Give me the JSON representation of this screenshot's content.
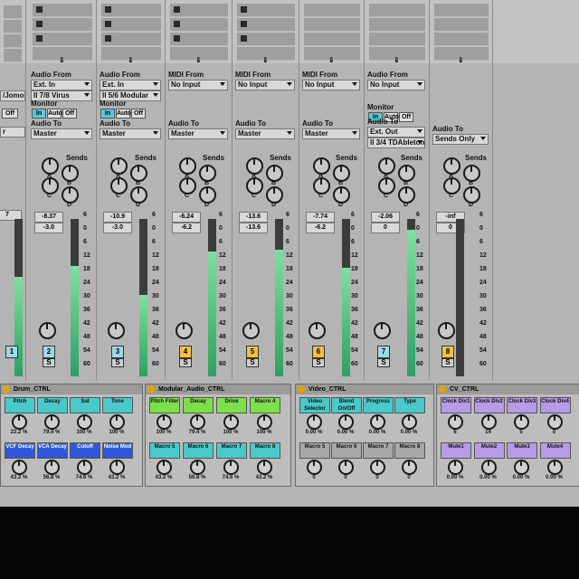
{
  "colors": {
    "aqua": "#49c9c9",
    "green": "#7de04a",
    "blue": "#2f58d8",
    "purple": "#b79be6",
    "meter_green": "#3fb56e",
    "yellow": "#f0c040"
  },
  "tracks": [
    {
      "io_label": "Audio From",
      "input": "Ext. In",
      "channel": "7/8 Virus",
      "monitor_label": "Monitor",
      "monitor": [
        "In",
        "Auto",
        "Off"
      ],
      "out_label": "Audio To",
      "output": "Master",
      "sends": "Sends",
      "vol": "-8.37",
      "peak": "-3.0",
      "num": "2",
      "num_color": "#9fd8e6"
    },
    {
      "io_label": "Audio From",
      "input": "Ext. In",
      "channel": "5/6 Modular",
      "monitor_label": "Monitor",
      "monitor": [
        "In",
        "Auto",
        "Off"
      ],
      "out_label": "Audio To",
      "output": "Master",
      "sends": "Sends",
      "vol": "-10.9",
      "peak": "-3.0",
      "num": "3",
      "num_color": "#9fd8e6"
    },
    {
      "io_label": "MIDI From",
      "input": "No Input",
      "channel": "",
      "monitor_label": "",
      "monitor": [],
      "out_label": "Audio To",
      "output": "Master",
      "sends": "Sends",
      "vol": "-6.24",
      "peak": "-6.2",
      "num": "4",
      "num_color": "#f0c040"
    },
    {
      "io_label": "MIDI From",
      "input": "No Input",
      "channel": "",
      "monitor_label": "",
      "monitor": [],
      "out_label": "Audio To",
      "output": "Master",
      "sends": "Sends",
      "vol": "-13.6",
      "peak": "-13.6",
      "num": "5",
      "num_color": "#f0c040"
    },
    {
      "io_label": "MIDI From",
      "input": "No Input",
      "channel": "",
      "monitor_label": "",
      "monitor": [],
      "out_label": "Audio To",
      "output": "Master",
      "sends": "Sends",
      "vol": "-7.74",
      "peak": "-6.2",
      "num": "6",
      "num_color": "#f0c040"
    },
    {
      "io_label": "Audio From",
      "input": "No Input",
      "channel": "",
      "monitor_label": "Monitor",
      "monitor": [
        "In",
        "Auto",
        "Off"
      ],
      "out_label": "Audio To",
      "output": "Ext. Out",
      "channel_out": "3/4 TDAbleton",
      "sends": "Sends",
      "vol": "-2.06",
      "peak": "0",
      "num": "7",
      "num_color": "#9fd8e6"
    },
    {
      "io_label": "",
      "input": "",
      "channel": "",
      "monitor_label": "",
      "monitor": [],
      "out_label": "Audio To",
      "output": "Sends Only",
      "sends": "Sends",
      "vol": "-inf",
      "peak": "0",
      "num": "8",
      "num_color": "#f0c040"
    }
  ],
  "left_partial": {
    "channel": "/Jomo",
    "monitor_off": "Off",
    "output": "r",
    "vol": "7",
    "num": "1"
  },
  "scale": [
    "6",
    "0",
    "6",
    "12",
    "18",
    "24",
    "30",
    "36",
    "42",
    "48",
    "54",
    "60"
  ],
  "send_knobs": [
    "A",
    "B",
    "C",
    "D"
  ],
  "devices": [
    {
      "title": "Drum_CTRL",
      "row1": [
        {
          "label": "Pitch",
          "color": "#49c9c9"
        },
        {
          "label": "Decay",
          "color": "#49c9c9"
        },
        {
          "label": "Sat",
          "color": "#49c9c9"
        },
        {
          "label": "Tone",
          "color": "#49c9c9"
        }
      ],
      "row1_vals": [
        "22.2 %",
        "79.4 %",
        "100 %",
        "100 %"
      ],
      "row2": [
        {
          "label": "VCF Decay",
          "color": "#2f58d8"
        },
        {
          "label": "VCA Decay",
          "color": "#2f58d8"
        },
        {
          "label": "Cutoff",
          "color": "#2f58d8"
        },
        {
          "label": "Noise Mod",
          "color": "#2f58d8"
        }
      ],
      "row2_vals": [
        "43.2 %",
        "56.8 %",
        "74.6 %",
        "43.2 %"
      ]
    },
    {
      "title": "Modular_Audio_CTRL",
      "row1": [
        {
          "label": "Pitch Filter",
          "color": "#7de04a"
        },
        {
          "label": "Decay",
          "color": "#7de04a"
        },
        {
          "label": "Drive",
          "color": "#7de04a"
        },
        {
          "label": "Macro 4",
          "color": "#7de04a"
        }
      ],
      "row1_vals": [
        "100 %",
        "79.4 %",
        "100 %",
        "100 %"
      ],
      "row2": [
        {
          "label": "Macro 5",
          "color": "#49c9c9"
        },
        {
          "label": "Macro 6",
          "color": "#49c9c9"
        },
        {
          "label": "Macro 7",
          "color": "#49c9c9"
        },
        {
          "label": "Macro 8",
          "color": "#49c9c9"
        }
      ],
      "row2_vals": [
        "43.2 %",
        "56.8 %",
        "74.6 %",
        "43.2 %"
      ]
    },
    {
      "title": "Video_CTRL",
      "row1": [
        {
          "label": "Video Selector",
          "color": "#49c9c9"
        },
        {
          "label": "Blend On/Off",
          "color": "#49c9c9"
        },
        {
          "label": "Progress",
          "color": "#49c9c9"
        },
        {
          "label": "Type",
          "color": "#49c9c9"
        }
      ],
      "row1_vals": [
        "0.00 %",
        "0.00 %",
        "0.00 %",
        "0.00 %"
      ],
      "row2": [
        {
          "label": "Macro 5",
          "color": "#a8a8a8"
        },
        {
          "label": "Macro 6",
          "color": "#a8a8a8"
        },
        {
          "label": "Macro 7",
          "color": "#a8a8a8"
        },
        {
          "label": "Macro 8",
          "color": "#a8a8a8"
        }
      ],
      "row2_vals": [
        "0",
        "0",
        "0",
        "0"
      ]
    },
    {
      "title": "CV_CTRL",
      "row1": [
        {
          "label": "Clock Div1",
          "color": "#b79be6"
        },
        {
          "label": "Clock Div2",
          "color": "#b79be6"
        },
        {
          "label": "Clock Div3",
          "color": "#b79be6"
        },
        {
          "label": "Clock Div4",
          "color": "#b79be6"
        }
      ],
      "row1_vals": [
        "6",
        "14",
        "5",
        "0"
      ],
      "row2": [
        {
          "label": "Mute1",
          "color": "#b79be6"
        },
        {
          "label": "Mute2",
          "color": "#b79be6"
        },
        {
          "label": "Mute3",
          "color": "#b79be6"
        },
        {
          "label": "Mute4",
          "color": "#b79be6"
        }
      ],
      "row2_vals": [
        "0.00 %",
        "0.00 %",
        "0.00 %",
        "0.00 %"
      ]
    }
  ]
}
